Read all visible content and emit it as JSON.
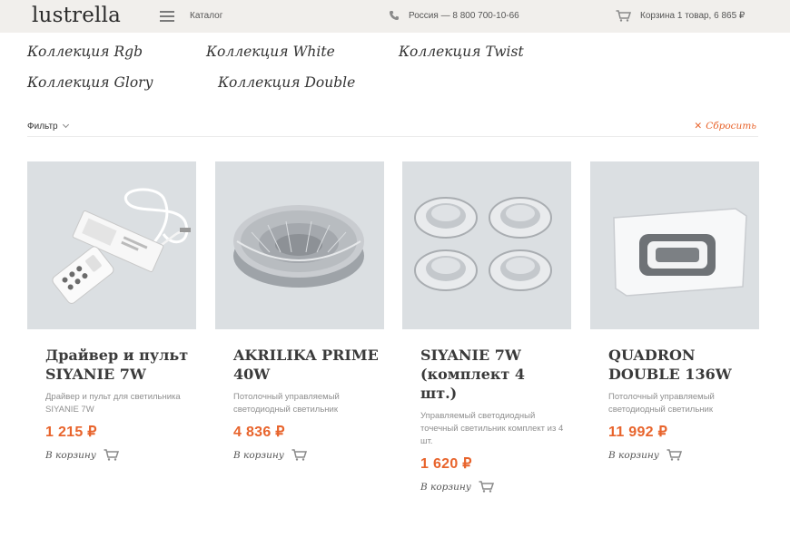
{
  "header": {
    "logo": "lustrella",
    "catalog_label": "Каталог",
    "phone": "Россия — 8 800 700-10-66",
    "cart": "Корзина 1 товар, 6 865 ₽"
  },
  "collections": [
    "Коллекция Rgb",
    "Коллекция White",
    "Коллекция Twist",
    "Коллекция Glory",
    "Коллекция Double"
  ],
  "filter": {
    "label": "Фильтр",
    "reset_label": "Сбросить"
  },
  "products": [
    {
      "title": "Драйвер и пульт SIYANIE 7W",
      "description": "Драйвер и пульт для светильника SIYANIE 7W",
      "price": "1 215 ₽",
      "buy_label": "В корзину"
    },
    {
      "title": "AKRILIKA PRIME 40W",
      "description": "Потолочный управляемый светодиодный светильник",
      "price": "4 836 ₽",
      "buy_label": "В корзину"
    },
    {
      "title": "SIYANIE 7W (комплект 4 шт.)",
      "description": "Управляемый светодиодный точечный светильник комплект из 4 шт.",
      "price": "1 620 ₽",
      "buy_label": "В корзину"
    },
    {
      "title": "QUADRON DOUBLE 136W",
      "description": "Потолочный управляемый светодиодный светильник",
      "price": "11 992 ₽",
      "buy_label": "В корзину"
    }
  ],
  "colors": {
    "accent": "#e8642c",
    "header_bg": "#f1efec",
    "image_bg": "#dbdfe2"
  }
}
